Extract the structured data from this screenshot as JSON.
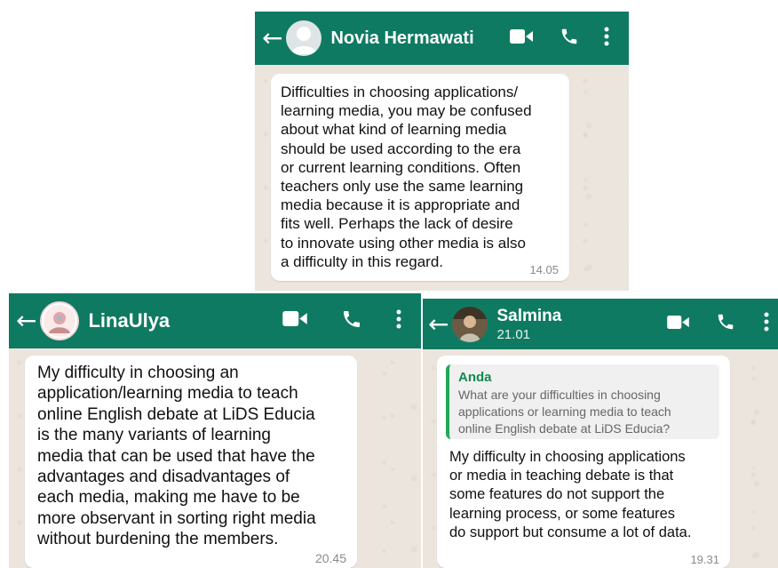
{
  "chats": [
    {
      "contact_name": "Novia Hermawati",
      "subtitle": "",
      "avatar_icon": "default-person-avatar",
      "message": "Difficulties in choosing applications/\nlearning media, you may be confused\nabout what kind of learning media\nshould be used according to the era\nor current learning conditions.  Often\nteachers only use the same learning\nmedia because it is appropriate and\nfits well.  Perhaps the lack of desire\nto innovate using other media is also\na difficulty in this regard.",
      "time": "14.05"
    },
    {
      "contact_name": "LinaUlya",
      "subtitle": "",
      "avatar_icon": "profile-photo-avatar",
      "message": "My difficulty in choosing an\napplication/learning media to teach\nonline English debate at LiDS Educia\nis the many variants of learning\nmedia that can be used that have the\nadvantages and disadvantages of\neach media, making me have to be\nmore observant in sorting right media\nwithout burdening the members.",
      "time": "20.45"
    },
    {
      "contact_name": "Salmina",
      "subtitle": "21.01",
      "avatar_icon": "profile-photo-avatar",
      "quote": {
        "author": "Anda",
        "text": "What are your difficulties in choosing\napplications or learning media to teach\nonline English debate at LiDS Educia?"
      },
      "message": "My difficulty in choosing applications\nor media in teaching debate is that\nsome features do not support the\nlearning process, or some features\ndo support but consume a lot of data.",
      "time": "19.31"
    }
  ],
  "icons": {
    "back": "back-arrow-icon",
    "video": "video-call-icon",
    "call": "phone-call-icon",
    "menu": "more-vertical-icon"
  },
  "colors": {
    "header": "#0f7a62",
    "chat_background": "#ece5dd",
    "bubble": "#ffffff",
    "timestamp": "#8a8a8a",
    "quote_bar": "#1fa855",
    "quote_author": "#138a52"
  }
}
